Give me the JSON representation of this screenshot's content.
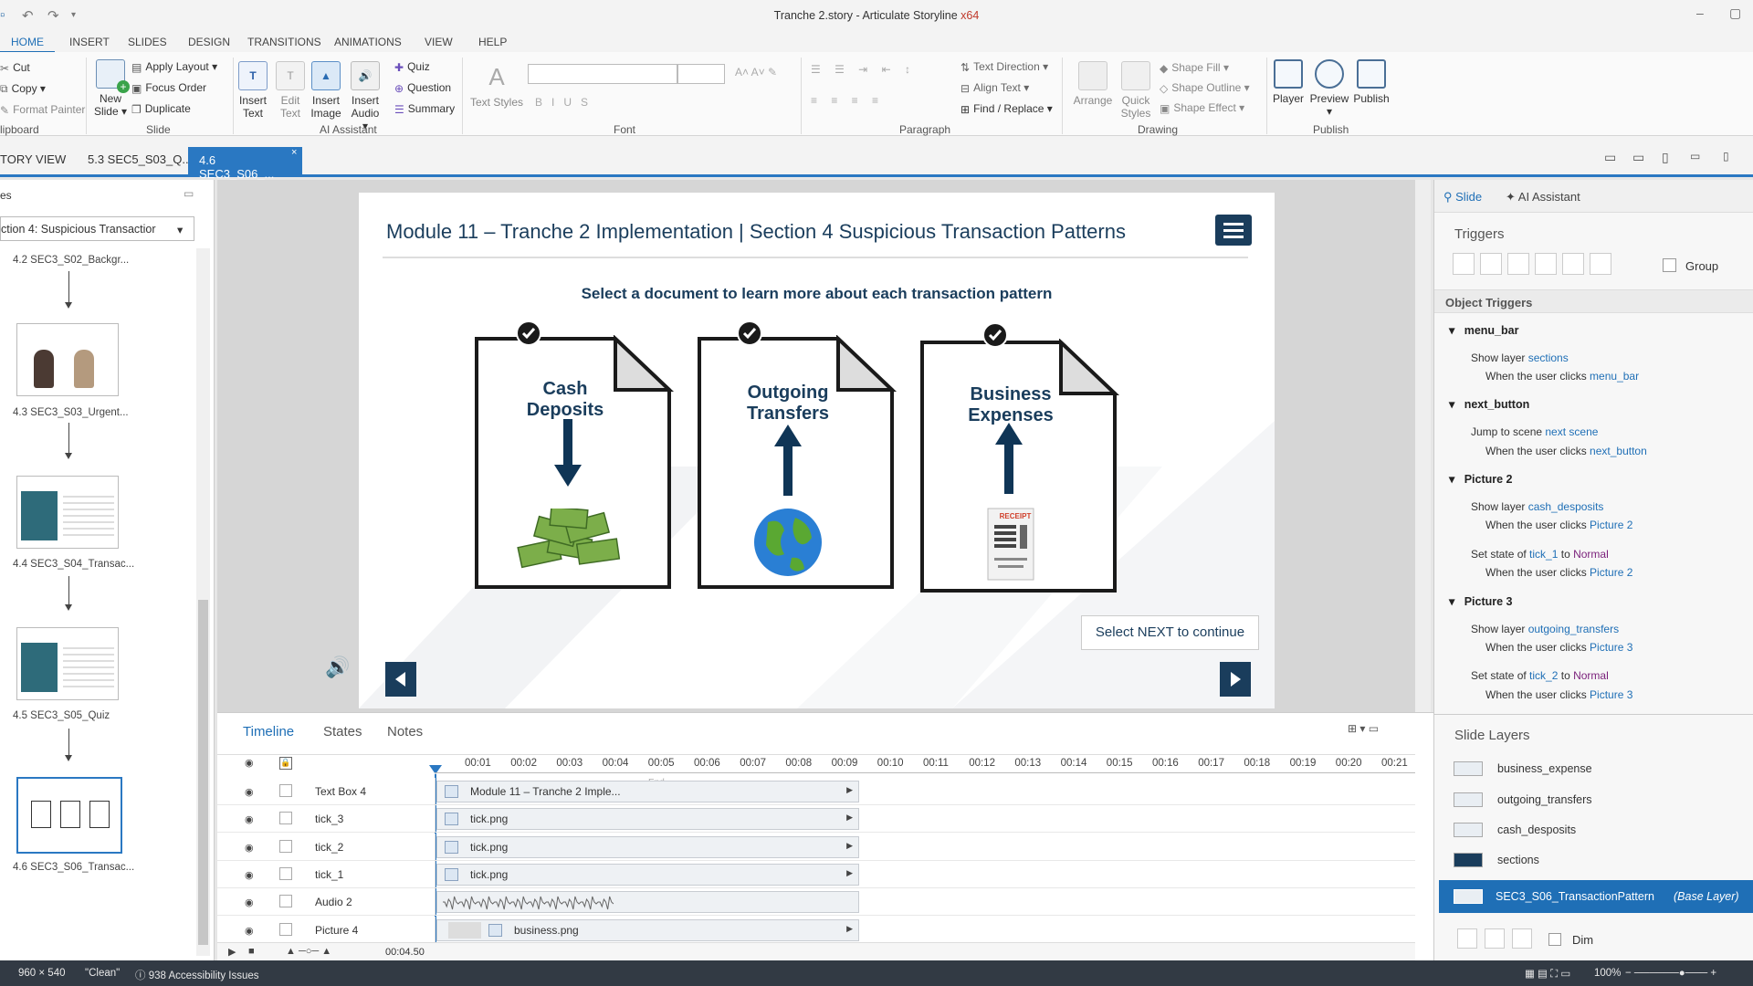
{
  "app": {
    "title": "Tranche 2.story - Articulate Storyline ",
    "arch": "x64"
  },
  "ribbon_tabs": [
    "HOME",
    "INSERT",
    "SLIDES",
    "DESIGN",
    "TRANSITIONS",
    "ANIMATIONS",
    "VIEW",
    "HELP"
  ],
  "ribbon": {
    "clipboard": {
      "cut": "Cut",
      "copy": "Copy",
      "format_painter": "Format Painter",
      "group": "lipboard"
    },
    "slide": {
      "new_slide": "New Slide",
      "apply_layout": "Apply Layout",
      "focus_order": "Focus Order",
      "duplicate": "Duplicate",
      "group": "Slide"
    },
    "ai": {
      "insert_text": "Insert Text",
      "edit_text": "Edit Text",
      "insert_image": "Insert Image",
      "insert_audio": "Insert Audio",
      "quiz": "Quiz",
      "question": "Question",
      "summary": "Summary",
      "group": "AI Assistant"
    },
    "font": {
      "text_styles": "Text Styles",
      "group": "Font"
    },
    "paragraph": {
      "text_direction": "Text Direction",
      "align_text": "Align Text",
      "find_replace": "Find / Replace",
      "group": "Paragraph"
    },
    "drawing": {
      "arrange": "Arrange",
      "quick_styles": "Quick Styles",
      "shape_fill": "Shape Fill",
      "shape_outline": "Shape Outline",
      "shape_effect": "Shape Effect",
      "group": "Drawing"
    },
    "publish": {
      "player": "Player",
      "preview": "Preview",
      "publish": "Publish",
      "group": "Publish"
    }
  },
  "doc_tabs": {
    "story_view": "TORY VIEW",
    "tab1": "5.3 SEC5_S03_Q...",
    "tab2": "4.6 SEC3_S06_..."
  },
  "left_panel": {
    "header": "es",
    "scene_select": "ction 4: Suspicious Transactior",
    "slides": [
      {
        "label": "4.2 SEC3_S02_Backgr..."
      },
      {
        "label": "4.3 SEC3_S03_Urgent..."
      },
      {
        "label": "4.4 SEC3_S04_Transac..."
      },
      {
        "label": "4.5 SEC3_S05_Quiz"
      },
      {
        "label": "4.6 SEC3_S06_Transac..."
      }
    ]
  },
  "slide": {
    "title": "Module 11 – Tranche 2 Implementation | Section 4 Suspicious Transaction Patterns",
    "instruction": "Select a document to learn more about each transaction pattern",
    "docs": [
      {
        "line1": "Cash",
        "line2": "Deposits"
      },
      {
        "line1": "Outgoing",
        "line2": "Transfers"
      },
      {
        "line1": "Business",
        "line2": "Expenses"
      }
    ],
    "receipt": "RECEIPT",
    "next_prompt": "Select NEXT to continue"
  },
  "right_panel": {
    "tab_slide": "Slide",
    "tab_ai": "AI Assistant",
    "triggers_header": "Triggers",
    "group_label": "Group",
    "object_triggers": "Object Triggers",
    "triggers": [
      {
        "object": "menu_bar",
        "actions": [
          {
            "verb": "Show layer ",
            "target": "sections",
            "when": "When the user clicks ",
            "obj": "menu_bar"
          }
        ]
      },
      {
        "object": "next_button",
        "actions": [
          {
            "verb": "Jump to scene ",
            "target": "next scene",
            "when": "When the user clicks ",
            "obj": "next_button"
          }
        ]
      },
      {
        "object": "Picture 2",
        "actions": [
          {
            "verb": "Show layer ",
            "target": "cash_desposits",
            "when": "When the user clicks ",
            "obj": "Picture 2"
          },
          {
            "verb": "Set state of ",
            "target": "tick_1",
            "mid": " to ",
            "state": "Normal",
            "when": "When the user clicks ",
            "obj": "Picture 2"
          }
        ]
      },
      {
        "object": "Picture 3",
        "actions": [
          {
            "verb": "Show layer ",
            "target": "outgoing_transfers",
            "when": "When the user clicks ",
            "obj": "Picture 3"
          },
          {
            "verb": "Set state of ",
            "target": "tick_2",
            "mid": " to ",
            "state": "Normal",
            "when": "When the user clicks ",
            "obj": "Picture 3"
          }
        ]
      }
    ],
    "layers_header": "Slide Layers",
    "layers": [
      "business_expense",
      "outgoing_transfers",
      "cash_desposits",
      "sections"
    ],
    "base_layer": {
      "name": "SEC3_S06_TransactionPattern",
      "tag": "(Base Layer)"
    },
    "dim": "Dim"
  },
  "timeline": {
    "tabs": [
      "Timeline",
      "States",
      "Notes"
    ],
    "ticks": [
      "00:01",
      "00:02",
      "00:03",
      "00:04",
      "00:05",
      "00:06",
      "00:07",
      "00:08",
      "00:09",
      "00:10",
      "00:11",
      "00:12",
      "00:13",
      "00:14",
      "00:15",
      "00:16",
      "00:17",
      "00:18",
      "00:19",
      "00:20",
      "00:21"
    ],
    "end_label": "End",
    "rows": [
      {
        "name": "Text Box 4",
        "bar": "Module 11 – Tranche 2 Imple..."
      },
      {
        "name": "tick_3",
        "bar": "tick.png"
      },
      {
        "name": "tick_2",
        "bar": "tick.png"
      },
      {
        "name": "tick_1",
        "bar": "tick.png"
      },
      {
        "name": "Audio 2",
        "bar": ""
      },
      {
        "name": "Picture 4",
        "bar": "business.png"
      }
    ],
    "time": "00:04.50"
  },
  "status": {
    "dims": "960 × 540",
    "theme": "\"Clean\"",
    "accessibility": "938 Accessibility Issues",
    "zoom": "100%"
  }
}
